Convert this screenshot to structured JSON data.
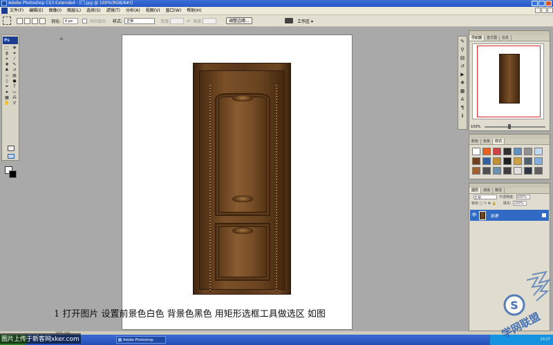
{
  "window": {
    "title": "Adobe Photoshop CS3 Extended - [门.jpg @ 100%(RGB/8#)]"
  },
  "menu": [
    "文件(F)",
    "编辑(E)",
    "图像(I)",
    "图层(L)",
    "选择(S)",
    "滤镜(T)",
    "分析(A)",
    "视图(V)",
    "窗口(W)",
    "帮助(H)"
  ],
  "options": {
    "feather_label": "羽化:",
    "feather_value": "0 px",
    "antialias_label": "消除锯齿",
    "style_label": "样式:",
    "style_value": "正常",
    "width_label": "宽度:",
    "height_label": "高度:",
    "refine_button": "调整边缘...",
    "workspace": "工作区 ▾"
  },
  "toolbox": {
    "logo": "Ps"
  },
  "canvas": {
    "caption": "1 打开图片 设置前景色白色 背景色黑色 用矩形选框工具做选区 如图"
  },
  "navigator": {
    "tabs": [
      "导航器",
      "直方图",
      "信息"
    ],
    "zoom": "100%"
  },
  "styles_panel": {
    "tabs": [
      "颜色",
      "色板",
      "样式"
    ],
    "swatches": [
      "#ffffff",
      "#e86020",
      "#d04040",
      "#303030",
      "#6090c0",
      "#909090",
      "#c0d8f0",
      "#704020",
      "#3060a0",
      "#c09030",
      "#202020",
      "#d0a040",
      "#506070",
      "#80b0e0",
      "#a06030",
      "#505050",
      "#7090b0",
      "#404040",
      "#e0e0e0",
      "#303848",
      "#606060"
    ]
  },
  "layers_panel": {
    "tabs": [
      "图层",
      "通道",
      "路径"
    ],
    "blend_mode": "正常",
    "opacity_label": "不透明度:",
    "opacity_value": "100%",
    "lock_label": "锁定:",
    "fill_label": "填充:",
    "fill_value": "100%",
    "layer_name": "背景"
  },
  "status": {
    "text": "100%  文档:..."
  },
  "taskbar": {
    "task": "Adobe Photoshop",
    "clock": "23:27"
  },
  "overlay": {
    "upload_text": "图片上传于新客网xker.com"
  },
  "watermark_logo": {
    "text": "学网联盟"
  }
}
